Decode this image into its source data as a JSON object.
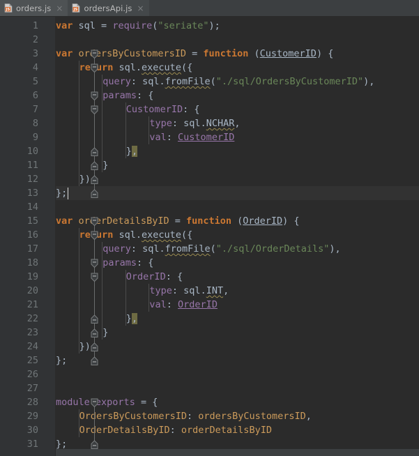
{
  "window": {
    "app": "jetbrains-ide-editor",
    "theme": "darcula"
  },
  "tabs": [
    {
      "label": "orders.js",
      "icon": "js-file-icon",
      "close": "×",
      "active": true
    },
    {
      "label": "ordersApi.js",
      "icon": "js-file-icon",
      "close": "×",
      "active": false
    }
  ],
  "editor": {
    "language": "javascript",
    "current_line": 13,
    "caret": {
      "line": 13,
      "column": 3
    },
    "first_visible_line": 1,
    "last_visible_line": 31,
    "colors": {
      "background": "#2b2b2b",
      "gutter_background": "#313335",
      "current_line_background": "#323232",
      "line_number": "#707678",
      "default_text": "#a9b7c6",
      "keyword": "#cc7832",
      "string": "#6a8759",
      "property": "#9876aa",
      "field": "#cc9b5b",
      "warning_highlight": "#6e6b43",
      "squiggle": "#9a8b4f",
      "tab_active": "#4e5254",
      "tab_inactive": "#44484a",
      "titlebar": "#3c3f41"
    },
    "lines": [
      {
        "n": 1,
        "indent": 0,
        "fold": null,
        "tokens": [
          {
            "t": "var",
            "c": "kw"
          },
          {
            "t": " ",
            "c": "punct"
          },
          {
            "t": "sql",
            "c": "ident"
          },
          {
            "t": " = ",
            "c": "punct"
          },
          {
            "t": "require",
            "c": "prop"
          },
          {
            "t": "(",
            "c": "punct"
          },
          {
            "t": "\"seriate\"",
            "c": "str"
          },
          {
            "t": ");",
            "c": "punct"
          }
        ]
      },
      {
        "n": 2,
        "indent": 0,
        "fold": null,
        "tokens": []
      },
      {
        "n": 3,
        "indent": 0,
        "fold": "open-top",
        "tokens": [
          {
            "t": "var",
            "c": "kw"
          },
          {
            "t": " ",
            "c": "punct"
          },
          {
            "t": "ordersByCustomersID",
            "c": "field"
          },
          {
            "t": " = ",
            "c": "punct"
          },
          {
            "t": "function",
            "c": "fn"
          },
          {
            "t": " (",
            "c": "punct"
          },
          {
            "t": "CustomerID",
            "c": "paramdecl"
          },
          {
            "t": ") {",
            "c": "punct"
          }
        ]
      },
      {
        "n": 4,
        "indent": 1,
        "fold": "open-top",
        "tokens": [
          {
            "t": "return",
            "c": "kw"
          },
          {
            "t": " ",
            "c": "punct"
          },
          {
            "t": "sql",
            "c": "ident"
          },
          {
            "t": ".",
            "c": "punct"
          },
          {
            "t": "execute",
            "c": "ident squig"
          },
          {
            "t": "({",
            "c": "punct"
          }
        ]
      },
      {
        "n": 5,
        "indent": 2,
        "fold": null,
        "tokens": [
          {
            "t": "query",
            "c": "prop"
          },
          {
            "t": ": ",
            "c": "punct"
          },
          {
            "t": "sql",
            "c": "ident"
          },
          {
            "t": ".",
            "c": "punct"
          },
          {
            "t": "fromFile",
            "c": "ident squig"
          },
          {
            "t": "(",
            "c": "punct"
          },
          {
            "t": "\"./sql/OrdersByCustomerID\"",
            "c": "str"
          },
          {
            "t": "),",
            "c": "punct"
          }
        ]
      },
      {
        "n": 6,
        "indent": 2,
        "fold": "open-top",
        "tokens": [
          {
            "t": "params",
            "c": "prop"
          },
          {
            "t": ": {",
            "c": "punct"
          }
        ]
      },
      {
        "n": 7,
        "indent": 3,
        "fold": "open-top",
        "tokens": [
          {
            "t": "CustomerID",
            "c": "prop"
          },
          {
            "t": ": {",
            "c": "punct"
          }
        ]
      },
      {
        "n": 8,
        "indent": 4,
        "fold": null,
        "tokens": [
          {
            "t": "type",
            "c": "prop"
          },
          {
            "t": ": ",
            "c": "punct"
          },
          {
            "t": "sql",
            "c": "ident"
          },
          {
            "t": ".",
            "c": "punct"
          },
          {
            "t": "NCHAR",
            "c": "ident squig"
          },
          {
            "t": ",",
            "c": "punct"
          }
        ]
      },
      {
        "n": 9,
        "indent": 4,
        "fold": null,
        "tokens": [
          {
            "t": "val",
            "c": "prop"
          },
          {
            "t": ": ",
            "c": "punct"
          },
          {
            "t": "CustomerID",
            "c": "param"
          }
        ]
      },
      {
        "n": 10,
        "indent": 3,
        "fold": "open-bottom",
        "tokens": [
          {
            "t": "}",
            "c": "brace"
          },
          {
            "t": ",",
            "c": "punct warnbg"
          }
        ]
      },
      {
        "n": 11,
        "indent": 2,
        "fold": "open-bottom",
        "tokens": [
          {
            "t": "}",
            "c": "brace"
          }
        ]
      },
      {
        "n": 12,
        "indent": 1,
        "fold": "open-bottom",
        "tokens": [
          {
            "t": "});",
            "c": "punct"
          }
        ]
      },
      {
        "n": 13,
        "indent": 0,
        "fold": "open-bottom",
        "tokens": [
          {
            "t": "};",
            "c": "punct"
          }
        ]
      },
      {
        "n": 14,
        "indent": 0,
        "fold": null,
        "tokens": []
      },
      {
        "n": 15,
        "indent": 0,
        "fold": "open-top",
        "tokens": [
          {
            "t": "var",
            "c": "kw"
          },
          {
            "t": " ",
            "c": "punct"
          },
          {
            "t": "orderDetailsByID",
            "c": "field"
          },
          {
            "t": " = ",
            "c": "punct"
          },
          {
            "t": "function",
            "c": "fn"
          },
          {
            "t": " (",
            "c": "punct"
          },
          {
            "t": "OrderID",
            "c": "paramdecl"
          },
          {
            "t": ") {",
            "c": "punct"
          }
        ]
      },
      {
        "n": 16,
        "indent": 1,
        "fold": "open-top",
        "tokens": [
          {
            "t": "return",
            "c": "kw"
          },
          {
            "t": " ",
            "c": "punct"
          },
          {
            "t": "sql",
            "c": "ident"
          },
          {
            "t": ".",
            "c": "punct"
          },
          {
            "t": "execute",
            "c": "ident squig"
          },
          {
            "t": "({",
            "c": "punct"
          }
        ]
      },
      {
        "n": 17,
        "indent": 2,
        "fold": null,
        "tokens": [
          {
            "t": "query",
            "c": "prop"
          },
          {
            "t": ": ",
            "c": "punct"
          },
          {
            "t": "sql",
            "c": "ident"
          },
          {
            "t": ".",
            "c": "punct"
          },
          {
            "t": "fromFile",
            "c": "ident squig"
          },
          {
            "t": "(",
            "c": "punct"
          },
          {
            "t": "\"./sql/OrderDetails\"",
            "c": "str"
          },
          {
            "t": "),",
            "c": "punct"
          }
        ]
      },
      {
        "n": 18,
        "indent": 2,
        "fold": "open-top",
        "tokens": [
          {
            "t": "params",
            "c": "prop"
          },
          {
            "t": ": {",
            "c": "punct"
          }
        ]
      },
      {
        "n": 19,
        "indent": 3,
        "fold": "open-top",
        "tokens": [
          {
            "t": "OrderID",
            "c": "prop"
          },
          {
            "t": ": {",
            "c": "punct"
          }
        ]
      },
      {
        "n": 20,
        "indent": 4,
        "fold": null,
        "tokens": [
          {
            "t": "type",
            "c": "prop"
          },
          {
            "t": ": ",
            "c": "punct"
          },
          {
            "t": "sql",
            "c": "ident"
          },
          {
            "t": ".",
            "c": "punct"
          },
          {
            "t": "INT",
            "c": "ident squig"
          },
          {
            "t": ",",
            "c": "punct"
          }
        ]
      },
      {
        "n": 21,
        "indent": 4,
        "fold": null,
        "tokens": [
          {
            "t": "val",
            "c": "prop"
          },
          {
            "t": ": ",
            "c": "punct"
          },
          {
            "t": "OrderID",
            "c": "param"
          }
        ]
      },
      {
        "n": 22,
        "indent": 3,
        "fold": "open-bottom",
        "tokens": [
          {
            "t": "}",
            "c": "brace"
          },
          {
            "t": ",",
            "c": "punct warnbg"
          }
        ]
      },
      {
        "n": 23,
        "indent": 2,
        "fold": "open-bottom",
        "tokens": [
          {
            "t": "}",
            "c": "brace"
          }
        ]
      },
      {
        "n": 24,
        "indent": 1,
        "fold": "open-bottom",
        "tokens": [
          {
            "t": "});",
            "c": "punct"
          }
        ]
      },
      {
        "n": 25,
        "indent": 0,
        "fold": "open-bottom",
        "tokens": [
          {
            "t": "};",
            "c": "punct"
          }
        ]
      },
      {
        "n": 26,
        "indent": 0,
        "fold": null,
        "tokens": []
      },
      {
        "n": 27,
        "indent": 0,
        "fold": null,
        "tokens": []
      },
      {
        "n": 28,
        "indent": 0,
        "fold": "open-top",
        "tokens": [
          {
            "t": "module",
            "c": "prop"
          },
          {
            "t": ".",
            "c": "punct"
          },
          {
            "t": "exports",
            "c": "prop"
          },
          {
            "t": " = {",
            "c": "punct"
          }
        ]
      },
      {
        "n": 29,
        "indent": 1,
        "fold": null,
        "tokens": [
          {
            "t": "OrdersByCustomersID",
            "c": "field"
          },
          {
            "t": ": ",
            "c": "punct"
          },
          {
            "t": "ordersByCustomersID",
            "c": "field"
          },
          {
            "t": ",",
            "c": "punct"
          }
        ]
      },
      {
        "n": 30,
        "indent": 1,
        "fold": null,
        "tokens": [
          {
            "t": "OrderDetailsByID",
            "c": "field"
          },
          {
            "t": ": ",
            "c": "punct"
          },
          {
            "t": "orderDetailsByID",
            "c": "field"
          }
        ]
      },
      {
        "n": 31,
        "indent": 0,
        "fold": "open-bottom",
        "tokens": [
          {
            "t": "};",
            "c": "punct"
          }
        ]
      }
    ],
    "fold_regions": [
      {
        "start": 3,
        "end": 13
      },
      {
        "start": 4,
        "end": 12
      },
      {
        "start": 6,
        "end": 11
      },
      {
        "start": 7,
        "end": 10
      },
      {
        "start": 15,
        "end": 25
      },
      {
        "start": 16,
        "end": 24
      },
      {
        "start": 18,
        "end": 23
      },
      {
        "start": 19,
        "end": 22
      },
      {
        "start": 28,
        "end": 31
      }
    ]
  }
}
